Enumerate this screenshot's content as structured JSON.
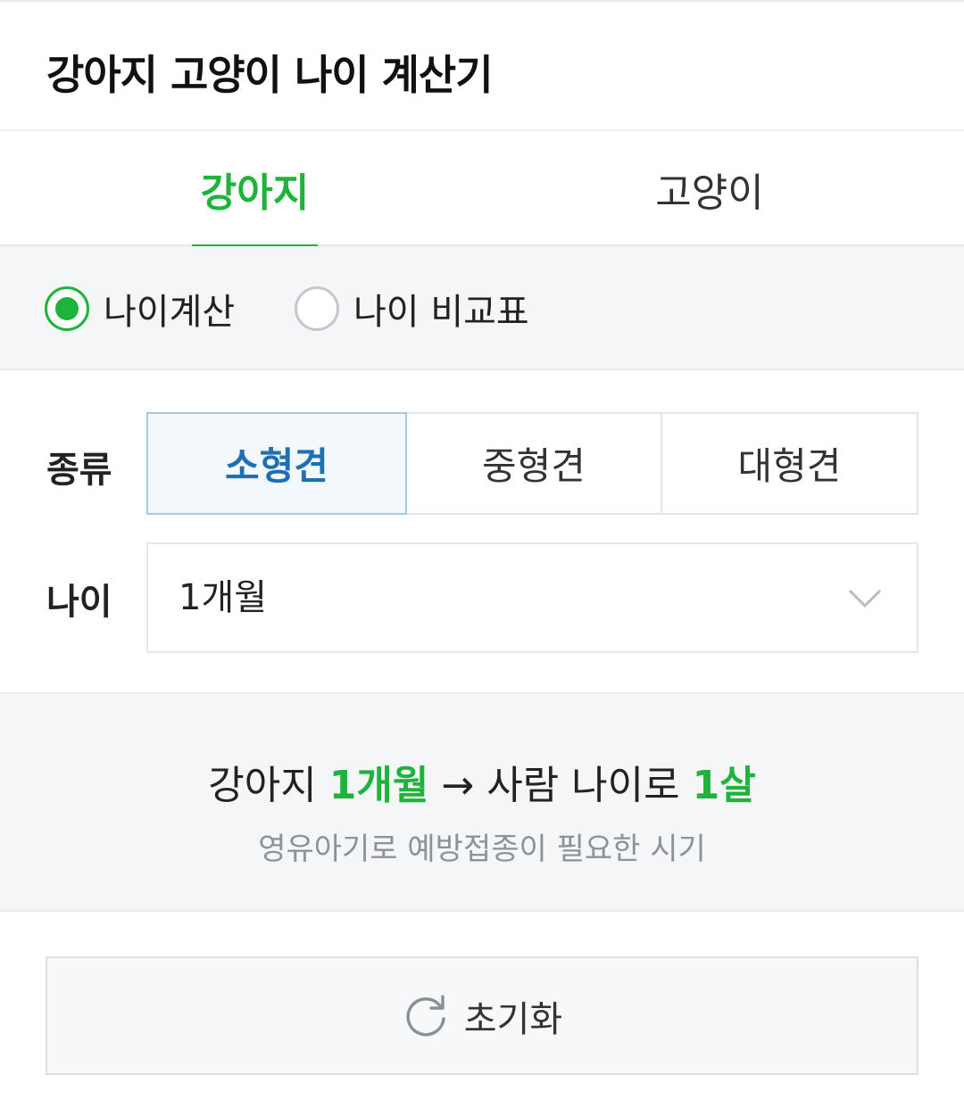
{
  "header": {
    "title": "강아지 고양이 나이 계산기"
  },
  "tabs": [
    {
      "label": "강아지",
      "active": true
    },
    {
      "label": "고양이",
      "active": false
    }
  ],
  "mode": {
    "options": [
      {
        "label": "나이계산",
        "selected": true
      },
      {
        "label": "나이 비교표",
        "selected": false
      }
    ]
  },
  "form": {
    "kind_label": "종류",
    "kinds": [
      {
        "label": "소형견",
        "selected": true
      },
      {
        "label": "중형견",
        "selected": false
      },
      {
        "label": "대형견",
        "selected": false
      }
    ],
    "age_label": "나이",
    "age_value": "1개월"
  },
  "result": {
    "prefix": "강아지",
    "pet_age": "1개월",
    "arrow": "→",
    "middle": "사람 나이로",
    "human_age": "1살",
    "note": "영유아기로 예방접종이 필요한 시기"
  },
  "reset": {
    "label": "초기화",
    "icon": "refresh-icon"
  },
  "colors": {
    "accent": "#1eb33a",
    "selected_blue": "#1f6fb5"
  }
}
